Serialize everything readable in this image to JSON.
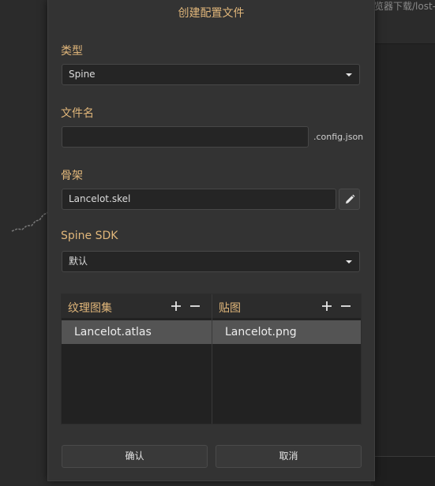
{
  "dialog": {
    "title": "创建配置文件",
    "type_label": "类型",
    "type_value": "Spine",
    "filename_label": "文件名",
    "filename_value": "",
    "filename_suffix": ".config.json",
    "skeleton_label": "骨架",
    "skeleton_value": "Lancelot.skel",
    "sdk_label": "Spine SDK",
    "sdk_value": "默认",
    "atlas_header": "纹理图集",
    "atlas_items": [
      "Lancelot.atlas"
    ],
    "texture_header": "贴图",
    "texture_items": [
      "Lancelot.png"
    ],
    "confirm_label": "确认",
    "cancel_label": "取消"
  },
  "background": {
    "right_text": "览器下载/lost-"
  },
  "colors": {
    "accent": "#e0b67a",
    "dialog_bg": "#333333",
    "selected_row": "#545454"
  },
  "icons": {
    "dropdown": "chevron-down-icon",
    "edit": "pencil-icon",
    "add": "plus-icon",
    "remove": "minus-icon"
  }
}
